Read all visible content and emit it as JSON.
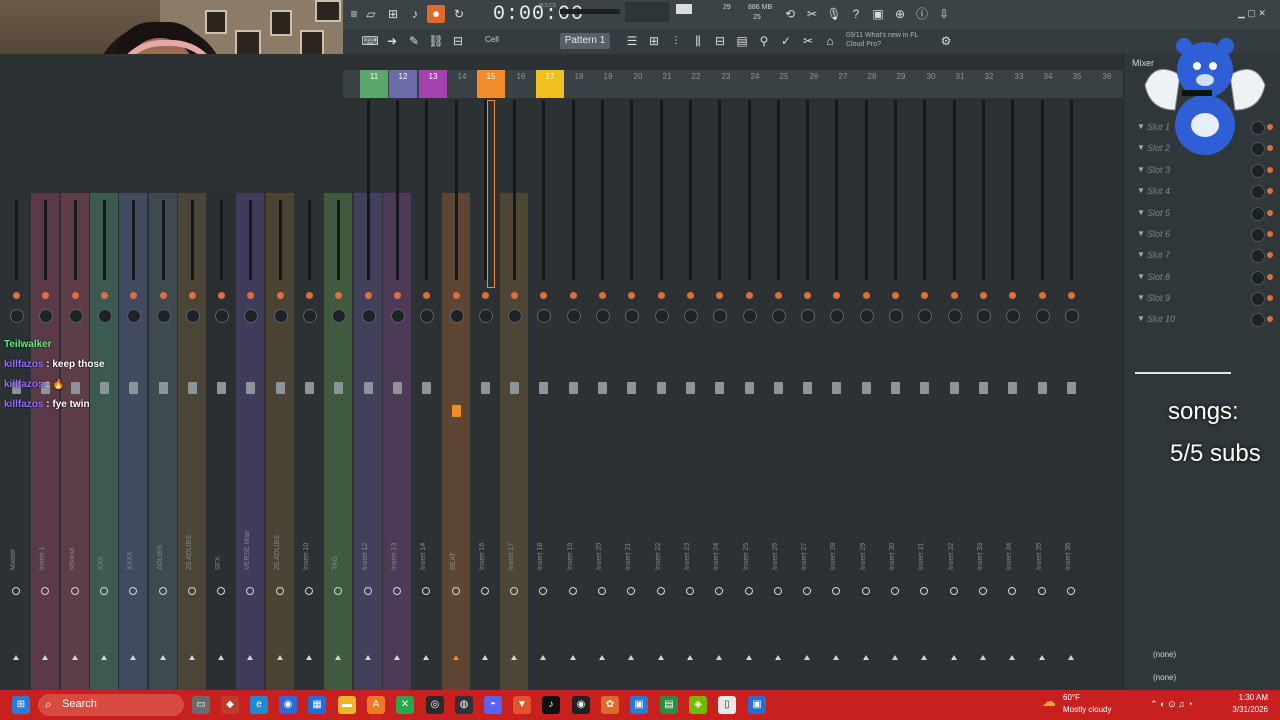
{
  "window": {
    "time_display": "0:00:00",
    "time_small": "M:S:CS",
    "cpu_mem": "886 MB",
    "cpu_poly": "29",
    "cpu_poly2": "25",
    "pattern_label": "Pattern 1",
    "snap_label": "Cell",
    "hint_text": "03/11  What's new in FL Cloud Pro?"
  },
  "chat": [
    {
      "user": "Teilwalker",
      "text": ""
    },
    {
      "user": "killfazos",
      "text": ": keep those"
    },
    {
      "user": "killfazos",
      "text": ": 🔥"
    },
    {
      "user": "killfazos",
      "text": ": fye twin"
    }
  ],
  "mixer": {
    "title": "Mixer",
    "scale": [
      "3",
      "6",
      "9",
      "12",
      "24",
      "27",
      "30",
      "33",
      "36"
    ],
    "header_numbers": [
      "11",
      "12",
      "13",
      "14",
      "15",
      "16",
      "17",
      "18",
      "19",
      "20",
      "21",
      "22",
      "23",
      "24",
      "25",
      "26",
      "27",
      "28",
      "29",
      "30",
      "31",
      "32",
      "33",
      "34",
      "35",
      "36"
    ],
    "tracks": [
      {
        "name": "Master",
        "color": "#2c3134"
      },
      {
        "name": "Insert 1",
        "color": "#5a3a49"
      },
      {
        "name": "sfsonia",
        "color": "#5e3e46"
      },
      {
        "name": "XXX",
        "color": "#3b5a51"
      },
      {
        "name": "XXXX",
        "color": "#414a5e"
      },
      {
        "name": "ADLIBS",
        "color": "#3e4a4f"
      },
      {
        "name": "2S ADLIBS",
        "color": "#4a4536"
      },
      {
        "name": "SFX",
        "color": "#2a2f32"
      },
      {
        "name": "VERSE Main",
        "color": "#403b5b"
      },
      {
        "name": "2S ADLIBS",
        "color": "#4b4434"
      },
      {
        "name": "Insert 10",
        "color": "#2c3134"
      },
      {
        "name": "TAG",
        "color": "#3f5a3d"
      },
      {
        "name": "Insert 12",
        "color": "#43405a"
      },
      {
        "name": "Insert 13",
        "color": "#4c3a56"
      },
      {
        "name": "Insert 14",
        "color": "#2c3134"
      },
      {
        "name": "BEAT",
        "color": "#5e4634"
      },
      {
        "name": "Insert 16",
        "color": "#2c3134"
      },
      {
        "name": "Insert 17",
        "color": "#4d4634"
      },
      {
        "name": "Insert 18",
        "color": "#2c3134"
      },
      {
        "name": "Insert 19",
        "color": "#2c3134"
      },
      {
        "name": "Insert 20",
        "color": "#2c3134"
      },
      {
        "name": "Insert 21",
        "color": "#2c3134"
      },
      {
        "name": "Insert 22",
        "color": "#2c3134"
      },
      {
        "name": "Insert 23",
        "color": "#2c3134"
      },
      {
        "name": "Insert 24",
        "color": "#2c3134"
      },
      {
        "name": "Insert 25",
        "color": "#2c3134"
      },
      {
        "name": "Insert 26",
        "color": "#2c3134"
      },
      {
        "name": "Insert 27",
        "color": "#2c3134"
      },
      {
        "name": "Insert 28",
        "color": "#2c3134"
      },
      {
        "name": "Insert 29",
        "color": "#2c3134"
      },
      {
        "name": "Insert 30",
        "color": "#2c3134"
      },
      {
        "name": "Insert 31",
        "color": "#2c3134"
      },
      {
        "name": "Insert 32",
        "color": "#2c3134"
      },
      {
        "name": "Insert 33",
        "color": "#2c3134"
      },
      {
        "name": "Insert 34",
        "color": "#2c3134"
      },
      {
        "name": "Insert 35",
        "color": "#2c3134"
      },
      {
        "name": "Insert 36",
        "color": "#2c3134"
      }
    ],
    "header_colors": {
      "11": "#5aa86b",
      "12": "#6c6ba8",
      "13": "#a642b0",
      "15": "#f08c2a",
      "17": "#f0c020"
    },
    "slots": [
      "Slot 3",
      "Slot 4",
      "Slot 5",
      "Slot 6",
      "Slot 7",
      "Slot 8",
      "Slot 9",
      "Slot 10"
    ],
    "slots_top": [
      "Slot 1",
      "Slot 2"
    ],
    "eq_none_1": "(none)",
    "eq_none_2": "(none)"
  },
  "overlay": {
    "songs_label": "songs:",
    "subs_label": "5/5 subs"
  },
  "taskbar": {
    "search_label": "Search",
    "temp": "60°F",
    "weather": "Mostly cloudy",
    "time": "1:30 AM",
    "date": "3/31/2026"
  },
  "colors": {
    "accent": "#e06a2c",
    "taskbar": "#c8201f",
    "knob_on": "#e26d3d"
  }
}
